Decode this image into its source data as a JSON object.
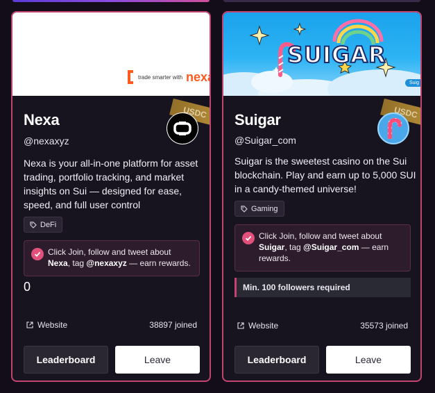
{
  "cards": [
    {
      "title": "Nexa",
      "handle": "@nexaxyz",
      "description": "Nexa is your all-in-one platform for asset trading, portfolio tracking, and market insights on Sui — designed for ease, speed, and full user control",
      "banner_text": "trade smarter with",
      "banner_brand": "nexa",
      "badge": "USDC",
      "tag": "DeFi",
      "notice_pre": "Click Join, follow and tweet about ",
      "notice_bold1": "Nexa",
      "notice_mid": ", tag ",
      "notice_bold2": "@nexaxyz",
      "notice_post": " — earn rewards.",
      "count": "0",
      "website_label": "Website",
      "joined": "38897 joined",
      "leaderboard_label": "Leaderboard",
      "leave_label": "Leave"
    },
    {
      "title": "Suigar",
      "handle": "@Suigar_com",
      "description": "Suigar is the sweetest casino on the Sui blockchain. Play and earn up to 5,000 SUI in a candy-themed universe!",
      "banner_text": "SUIGAR",
      "banner_side": "Suig",
      "badge": "USDC",
      "tag": "Gaming",
      "notice_pre": "Click Join, follow and tweet about ",
      "notice_bold1": "Suigar",
      "notice_mid": ", tag ",
      "notice_bold2": "@Suigar_com",
      "notice_post": " — earn rewards.",
      "requirement": "Min. 100 followers required",
      "website_label": "Website",
      "joined": "35573 joined",
      "leaderboard_label": "Leaderboard",
      "leave_label": "Leave"
    }
  ],
  "colors": {
    "accent": "#c2456f",
    "check": "#e2507c",
    "background": "#120d18",
    "card": "#17141f",
    "nexa_orange": "#ff5a1f"
  },
  "icons": {
    "tag": "tag-icon",
    "check": "check-circle-icon",
    "external": "external-link-icon"
  }
}
